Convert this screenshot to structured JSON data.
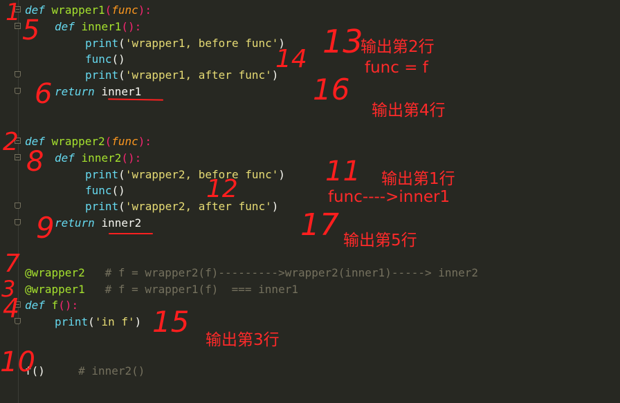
{
  "code": {
    "l1": {
      "kw": "def",
      "name": "wrapper1",
      "open": "(",
      "param": "func",
      "close": "):"
    },
    "l2": {
      "kw": "def",
      "name": "inner1",
      "sig": "():"
    },
    "l3": {
      "call": "print",
      "open": "(",
      "str": "'wrapper1, before func'",
      "close": ")"
    },
    "l4": {
      "call": "func",
      "rest": "()"
    },
    "l5": {
      "call": "print",
      "open": "(",
      "str": "'wrapper1, after func'",
      "close": ")"
    },
    "l6": {
      "kw": "return",
      "value": "inner1"
    },
    "l7": {
      "kw": "def",
      "name": "wrapper2",
      "open": "(",
      "param": "func",
      "close": "):"
    },
    "l8": {
      "kw": "def",
      "name": "inner2",
      "sig": "():"
    },
    "l9": {
      "call": "print",
      "open": "(",
      "str": "'wrapper2, before func'",
      "close": ")"
    },
    "l10": {
      "call": "func",
      "rest": "()"
    },
    "l11": {
      "call": "print",
      "open": "(",
      "str": "'wrapper2, after func'",
      "close": ")"
    },
    "l12": {
      "kw": "return",
      "value": "inner2"
    },
    "l13": {
      "deco": "@wrapper2",
      "comment": "# f = wrapper2(f)--------->wrapper2(inner1)-----> inner2"
    },
    "l14": {
      "deco": "@wrapper1",
      "comment": "# f = wrapper1(f)  === inner1"
    },
    "l15": {
      "kw": "def",
      "name": "f",
      "sig": "():"
    },
    "l16": {
      "call": "print",
      "open": "(",
      "str": "'in f'",
      "close": ")"
    },
    "l17": {
      "plain": "f()",
      "comment": "# inner2()"
    }
  },
  "annotations": {
    "a1": "输出第2行",
    "a2": "func = f",
    "a3": "输出第4行",
    "a4": "输出第1行",
    "a5": "func---->inner1",
    "a6": "输出第5行",
    "a7": "输出第3行"
  },
  "step_numbers": {
    "n1": "1",
    "n2": "2",
    "n3": "3",
    "n4": "4",
    "n5": "5",
    "n6": "6",
    "n7": "7",
    "n8": "8",
    "n9": "9",
    "n10": "10",
    "n11": "11",
    "n12": "12",
    "n13": "13",
    "n14": "14",
    "n15": "15",
    "n16": "16",
    "n17": "17"
  },
  "colors": {
    "background": "#272822",
    "keyword": "#66d9ef",
    "function_name": "#a6e22e",
    "parameter": "#fd971f",
    "string": "#e6db74",
    "comment": "#75715e",
    "annotation": "#ff2a2a"
  }
}
